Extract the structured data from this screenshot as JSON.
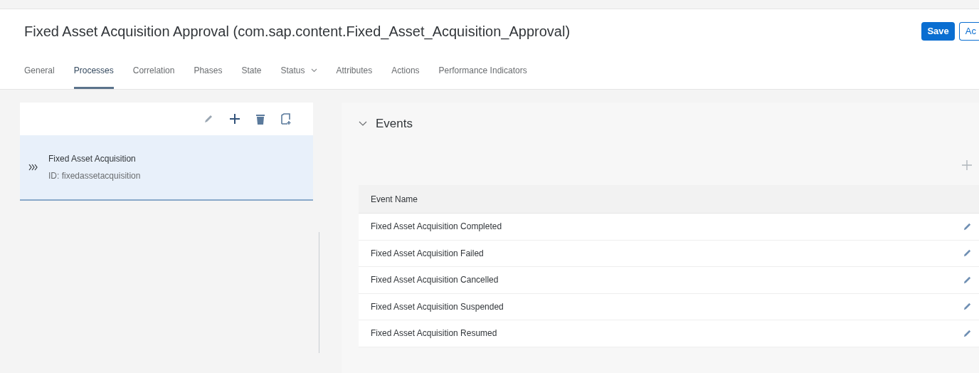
{
  "header": {
    "title": "Fixed Asset Acquisition Approval (com.sap.content.Fixed_Asset_Acquisition_Approval)",
    "buttons": [
      {
        "label": "Save",
        "kind": "primary"
      },
      {
        "label": "Ac",
        "kind": "secondary"
      }
    ]
  },
  "tabs": [
    {
      "label": "General",
      "selected": false
    },
    {
      "label": "Processes",
      "selected": true
    },
    {
      "label": "Correlation",
      "selected": false
    },
    {
      "label": "Phases",
      "selected": false
    },
    {
      "label": "State",
      "selected": false
    },
    {
      "label": "Status",
      "selected": false,
      "kind": "menu"
    },
    {
      "label": "Attributes",
      "selected": false
    },
    {
      "label": "Actions",
      "selected": false
    },
    {
      "label": "Performance Indicators",
      "selected": false
    }
  ],
  "process_list": {
    "items": [
      {
        "name": "Fixed Asset Acquisition",
        "id": "ID: fixedassetacquisition",
        "selected": true
      }
    ]
  },
  "events": {
    "title": "Events",
    "expanded": true,
    "columns": [
      "Event Name"
    ],
    "rows": [
      "Fixed Asset Acquisition Completed",
      "Fixed Asset Acquisition Failed",
      "Fixed Asset Acquisition Cancelled",
      "Fixed Asset Acquisition Suspended",
      "Fixed Asset Acquisition Resumed"
    ]
  }
}
